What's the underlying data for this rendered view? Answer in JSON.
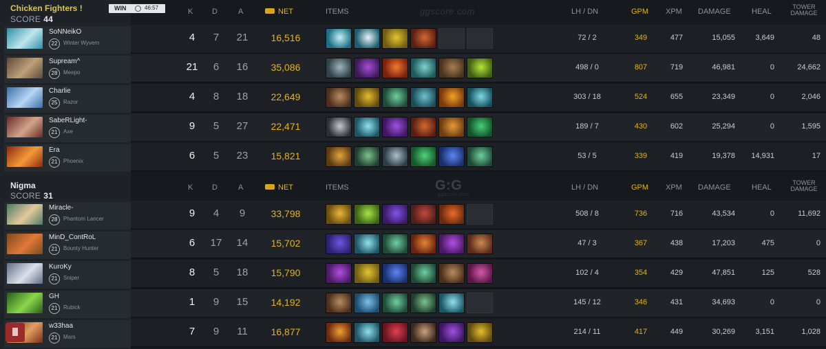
{
  "teams": [
    {
      "name": "Chicken Fighters !",
      "score_label": "SCORE",
      "score": "44",
      "name_color": "#d9c35a",
      "result": "WIN",
      "duration": "46:57",
      "headers": {
        "k": "K",
        "d": "D",
        "a": "A",
        "net": "NET",
        "items": "ITEMS",
        "lh": "LH / DN",
        "gpm": "GPM",
        "xpm": "XPM",
        "damage": "DAMAGE",
        "heal": "HEAL",
        "tower_line1": "TOWER",
        "tower_line2": "DAMAGE"
      },
      "watermark": "ggscore.com",
      "players": [
        {
          "name": "SoNNeikO",
          "level": "22",
          "hero": "Winter Wyvern",
          "portrait": [
            "#2f8fa8",
            "#bfe6ee"
          ],
          "k": "4",
          "d": "7",
          "a": "21",
          "net": "16,516",
          "lh": "72 / 2",
          "gpm": "349",
          "xpm": "477",
          "damage": "15,055",
          "heal": "3,649",
          "tower": "48",
          "items": [
            {
              "icon": "mjollnir-icon",
              "c": [
                "#1c6f86",
                "#c5f1f7"
              ]
            },
            {
              "icon": "eul-scepter-icon",
              "c": [
                "#1b5e6e",
                "#e7f4f6"
              ]
            },
            {
              "icon": "mekansm-icon",
              "c": [
                "#6f5d12",
                "#e5c533"
              ]
            },
            {
              "icon": "glimmer-cape-icon",
              "c": [
                "#5b1e14",
                "#d06a2f"
              ]
            },
            {
              "icon": "empty-slot",
              "c": null
            },
            {
              "icon": "empty-slot",
              "c": null
            }
          ]
        },
        {
          "name": "Supream^",
          "level": "28",
          "hero": "Meepo",
          "portrait": [
            "#5b4a3a",
            "#c0a07a"
          ],
          "k": "21",
          "d": "6",
          "a": "16",
          "net": "35,086",
          "lh": "498 / 0",
          "gpm": "807",
          "xpm": "719",
          "damage": "46,981",
          "heal": "0",
          "tower": "24,662",
          "items": [
            {
              "icon": "skull-basher-icon",
              "c": [
                "#304247",
                "#9fb5bd"
              ]
            },
            {
              "icon": "ethereal-blade-icon",
              "c": [
                "#3d1a57",
                "#a44cd6"
              ]
            },
            {
              "icon": "radiance-icon",
              "c": [
                "#7a2110",
                "#f17a2a"
              ]
            },
            {
              "icon": "blink-dagger-icon",
              "c": [
                "#1f5a5c",
                "#7fd2cc"
              ]
            },
            {
              "icon": "travel-boots-icon",
              "c": [
                "#4a3420",
                "#a77d4f"
              ]
            },
            {
              "icon": "aghanim-scepter-icon",
              "c": [
                "#3f5f12",
                "#b7e43b"
              ]
            }
          ]
        },
        {
          "name": "Charlie",
          "level": "25",
          "hero": "Razor",
          "portrait": [
            "#3a6ea8",
            "#b7d6f5"
          ],
          "k": "4",
          "d": "8",
          "a": "18",
          "net": "22,649",
          "lh": "303 / 18",
          "gpm": "524",
          "xpm": "655",
          "damage": "23,349",
          "heal": "0",
          "tower": "2,046",
          "items": [
            {
              "icon": "power-treads-icon",
              "c": [
                "#4b2f1c",
                "#b98c5f"
              ]
            },
            {
              "icon": "satanic-icon",
              "c": [
                "#5f4a10",
                "#e6bd2e"
              ]
            },
            {
              "icon": "blink-staff-icon",
              "c": [
                "#1f4a38",
                "#6fd0a0"
              ]
            },
            {
              "icon": "manta-icon",
              "c": [
                "#1a4d58",
                "#71c2cf"
              ]
            },
            {
              "icon": "daedalus-icon",
              "c": [
                "#7a3a0c",
                "#f2a228"
              ]
            },
            {
              "icon": "linkens-icon",
              "c": [
                "#14505a",
                "#7fd9e6"
              ]
            }
          ]
        },
        {
          "name": "SabeRLight-",
          "level": "21",
          "hero": "Axe",
          "portrait": [
            "#6a2a26",
            "#d2a48a"
          ],
          "k": "9",
          "d": "5",
          "a": "27",
          "net": "22,471",
          "lh": "189 / 7",
          "gpm": "430",
          "xpm": "602",
          "damage": "25,294",
          "heal": "0",
          "tower": "1,595",
          "items": [
            {
              "icon": "shivas-guard-icon",
              "c": [
                "#2e2e34",
                "#c6c9d0"
              ]
            },
            {
              "icon": "vanguard-icon",
              "c": [
                "#1e5665",
                "#8ee1ef"
              ]
            },
            {
              "icon": "dagon-icon",
              "c": [
                "#3e1664",
                "#a051e0"
              ]
            },
            {
              "icon": "glimmer-cape-icon",
              "c": [
                "#5b1e14",
                "#d06a2f"
              ]
            },
            {
              "icon": "desolator-icon",
              "c": [
                "#6b3d10",
                "#e89a38"
              ]
            },
            {
              "icon": "lotus-orb-icon",
              "c": [
                "#14512a",
                "#44d077"
              ]
            }
          ]
        },
        {
          "name": "Era",
          "level": "21",
          "hero": "Phoenix",
          "portrait": [
            "#8a2a0e",
            "#f39a38"
          ],
          "k": "6",
          "d": "5",
          "a": "23",
          "net": "15,821",
          "lh": "53 / 5",
          "gpm": "339",
          "xpm": "419",
          "damage": "19,378",
          "heal": "14,931",
          "tower": "17",
          "items": [
            {
              "icon": "holy-locket-icon",
              "c": [
                "#5c3a12",
                "#e1a53b"
              ]
            },
            {
              "icon": "force-staff-icon",
              "c": [
                "#213d2e",
                "#7bc38c"
              ]
            },
            {
              "icon": "crimson-guard-icon",
              "c": [
                "#2c3b44",
                "#aebfc8"
              ]
            },
            {
              "icon": "pipe-icon",
              "c": [
                "#155a2a",
                "#4fd27a"
              ]
            },
            {
              "icon": "ethereal-shard-icon",
              "c": [
                "#1b2f6e",
                "#5b86f2"
              ]
            },
            {
              "icon": "blink-staff-icon",
              "c": [
                "#1f4a38",
                "#6fd0a0"
              ]
            }
          ]
        }
      ]
    },
    {
      "name": "Nigma",
      "score_label": "SCORE",
      "score": "31",
      "name_color": "#e6e8eb",
      "headers": {
        "k": "K",
        "d": "D",
        "a": "A",
        "net": "NET",
        "items": "ITEMS",
        "lh": "LH / DN",
        "gpm": "GPM",
        "xpm": "XPM",
        "damage": "DAMAGE",
        "heal": "HEAL",
        "tower_line1": "TOWER",
        "tower_line2": "DAMAGE"
      },
      "watermark": "G:G",
      "watermark_sub": "ggscore.com",
      "players": [
        {
          "name": "Miracle-",
          "level": "28",
          "hero": "Phantom Lancer",
          "portrait": [
            "#4e7a6a",
            "#e1c99a"
          ],
          "k": "9",
          "d": "4",
          "a": "9",
          "net": "33,798",
          "lh": "508 / 8",
          "gpm": "736",
          "xpm": "716",
          "damage": "43,534",
          "heal": "0",
          "tower": "11,692",
          "items": [
            {
              "icon": "butterfly-icon",
              "c": [
                "#6b4e0f",
                "#e8b73a"
              ]
            },
            {
              "icon": "diffusal-icon",
              "c": [
                "#3d6416",
                "#a7e444"
              ]
            },
            {
              "icon": "skadi-icon",
              "c": [
                "#3b1a66",
                "#7f56e6"
              ]
            },
            {
              "icon": "sange-yasha-icon",
              "c": [
                "#4e1f1c",
                "#c2493c"
              ]
            },
            {
              "icon": "manta-icon",
              "c": [
                "#6a2a0e",
                "#ec6b2a"
              ]
            },
            {
              "icon": "empty-slot",
              "c": null
            }
          ]
        },
        {
          "name": "MinD_ContRoL",
          "level": "21",
          "hero": "Bounty Hunter",
          "portrait": [
            "#7a4a1c",
            "#e07838"
          ],
          "k": "6",
          "d": "17",
          "a": "14",
          "net": "15,702",
          "lh": "47 / 3",
          "gpm": "367",
          "xpm": "438",
          "damage": "17,203",
          "heal": "475",
          "tower": "0",
          "items": [
            {
              "icon": "boots-icon",
              "c": [
                "#2d2070",
                "#6d58e0"
              ]
            },
            {
              "icon": "vanguard-icon",
              "c": [
                "#1e5665",
                "#8ee1ef"
              ]
            },
            {
              "icon": "blink-staff-icon",
              "c": [
                "#1f4a38",
                "#6fd0a0"
              ]
            },
            {
              "icon": "orchid-icon",
              "c": [
                "#6a2510",
                "#e58238"
              ]
            },
            {
              "icon": "orb-of-venom-icon",
              "c": [
                "#4a1a66",
                "#b24fe0"
              ]
            },
            {
              "icon": "drum-icon",
              "c": [
                "#5a2a1a",
                "#cc8a52"
              ]
            }
          ]
        },
        {
          "name": "KuroKy",
          "level": "21",
          "hero": "Sniper",
          "portrait": [
            "#5e6f86",
            "#dbe0ea"
          ],
          "k": "8",
          "d": "5",
          "a": "18",
          "net": "15,790",
          "lh": "102 / 4",
          "gpm": "354",
          "xpm": "429",
          "damage": "47,851",
          "heal": "125",
          "tower": "528",
          "items": [
            {
              "icon": "orb-of-venom-icon",
              "c": [
                "#4a1a66",
                "#b24fe0"
              ]
            },
            {
              "icon": "mekansm-icon",
              "c": [
                "#6f5d12",
                "#e5c533"
              ]
            },
            {
              "icon": "kaya-icon",
              "c": [
                "#1b2f6e",
                "#5b86f2"
              ]
            },
            {
              "icon": "blink-staff-icon",
              "c": [
                "#1f4a38",
                "#6fd0a0"
              ]
            },
            {
              "icon": "tranquil-boots-icon",
              "c": [
                "#4b2f1c",
                "#b98c5f"
              ]
            },
            {
              "icon": "glimmer-orb-icon",
              "c": [
                "#5a1646",
                "#d45aa8"
              ]
            }
          ]
        },
        {
          "name": "GH",
          "level": "21",
          "hero": "Rubick",
          "portrait": [
            "#2a5a1a",
            "#8ad84a"
          ],
          "k": "1",
          "d": "9",
          "a": "15",
          "net": "14,192",
          "lh": "145 / 12",
          "gpm": "346",
          "xpm": "431",
          "damage": "34,693",
          "heal": "0",
          "tower": "0",
          "items": [
            {
              "icon": "arcane-boots-icon",
              "c": [
                "#4b2f1c",
                "#b98c5f"
              ]
            },
            {
              "icon": "aether-lens-icon",
              "c": [
                "#1c4c6e",
                "#7bc2e6"
              ]
            },
            {
              "icon": "blink-staff-icon",
              "c": [
                "#1f4a38",
                "#6fd0a0"
              ]
            },
            {
              "icon": "force-staff-icon",
              "c": [
                "#213d2e",
                "#7bc38c"
              ]
            },
            {
              "icon": "vanguard-icon",
              "c": [
                "#1e5665",
                "#8ee1ef"
              ]
            },
            {
              "icon": "empty-slot",
              "c": null
            }
          ]
        },
        {
          "name": "w33haa",
          "level": "21",
          "hero": "Mars",
          "portrait": [
            "#7a2a18",
            "#e0a060"
          ],
          "k": "7",
          "d": "9",
          "a": "11",
          "net": "16,877",
          "lh": "214 / 11",
          "gpm": "417",
          "xpm": "449",
          "damage": "30,269",
          "heal": "3,151",
          "tower": "1,028",
          "items": [
            {
              "icon": "blade-mail-icon",
              "c": [
                "#6a2a10",
                "#f0a030"
              ]
            },
            {
              "icon": "vanguard-icon",
              "c": [
                "#1e5665",
                "#8ee1ef"
              ]
            },
            {
              "icon": "heart-icon",
              "c": [
                "#6a1420",
                "#e0404f"
              ]
            },
            {
              "icon": "black-king-bar-icon",
              "c": [
                "#3e2a20",
                "#c9a27a"
              ]
            },
            {
              "icon": "dagon-icon",
              "c": [
                "#3e1664",
                "#a051e0"
              ]
            },
            {
              "icon": "satanic-icon",
              "c": [
                "#5f4a10",
                "#e6bd2e"
              ]
            }
          ]
        }
      ]
    }
  ],
  "colors": {
    "gold": "#e3b21c",
    "background": "#16191d",
    "row": "#1c2024"
  }
}
